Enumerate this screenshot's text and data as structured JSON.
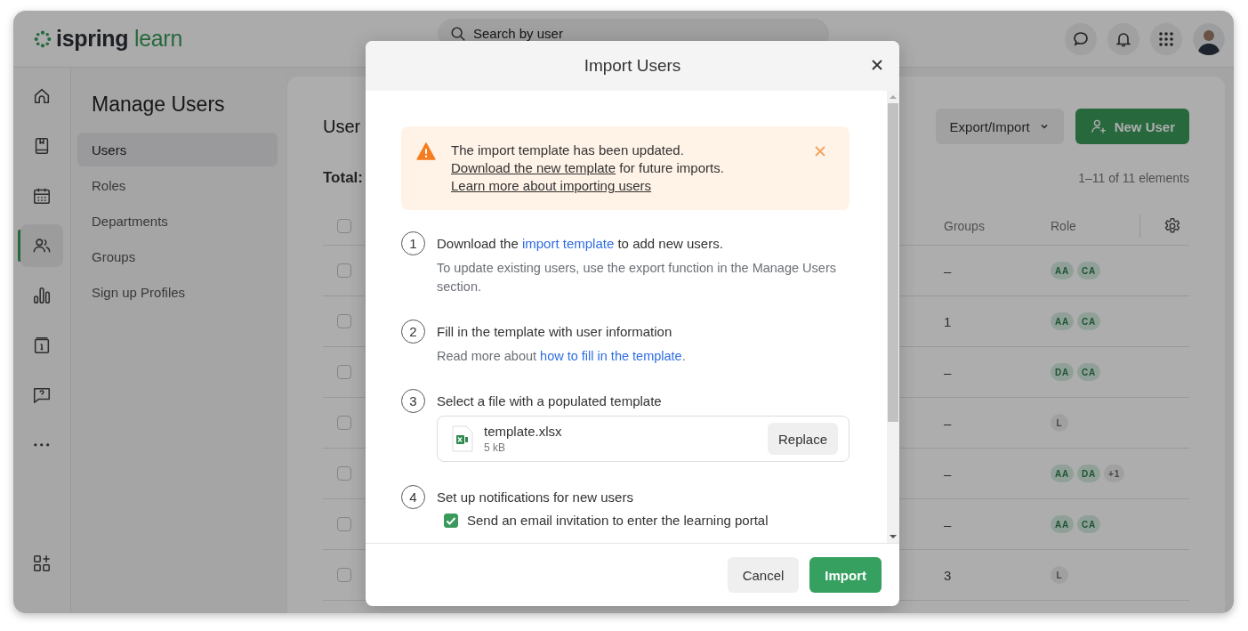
{
  "brand": {
    "name": "ispring",
    "product": "learn"
  },
  "search": {
    "placeholder": "Search by user"
  },
  "rail": [
    {
      "kind": "home",
      "selected": false
    },
    {
      "kind": "book",
      "selected": false
    },
    {
      "kind": "calendar",
      "selected": false
    },
    {
      "kind": "users",
      "selected": true
    },
    {
      "kind": "chart",
      "selected": false
    },
    {
      "kind": "info",
      "selected": false
    },
    {
      "kind": "help",
      "selected": false
    },
    {
      "kind": "more",
      "selected": false
    },
    {
      "kind": "apps",
      "selected": false
    }
  ],
  "sidebar": {
    "title": "Manage Users",
    "items": [
      {
        "label": "Users",
        "selected": true
      },
      {
        "label": "Roles",
        "selected": false
      },
      {
        "label": "Departments",
        "selected": false
      },
      {
        "label": "Groups",
        "selected": false
      },
      {
        "label": "Sign up Profiles",
        "selected": false
      }
    ]
  },
  "content": {
    "title": "User",
    "total_label": "Total:",
    "export_button": "Export/Import",
    "new_button": "New User",
    "range": "1–11 of 11 elements",
    "table": {
      "header_checked": false,
      "columns": [
        "Groups",
        "Role"
      ],
      "rows": [
        {
          "checked": false,
          "groups": "–",
          "roles": [
            {
              "label": "AA",
              "kind": "accent"
            },
            {
              "label": "CA",
              "kind": "accent"
            }
          ]
        },
        {
          "checked": false,
          "groups": "1",
          "roles": [
            {
              "label": "AA",
              "kind": "accent"
            },
            {
              "label": "CA",
              "kind": "accent"
            }
          ]
        },
        {
          "checked": false,
          "groups": "–",
          "roles": [
            {
              "label": "DA",
              "kind": "accent"
            },
            {
              "label": "CA",
              "kind": "accent"
            }
          ]
        },
        {
          "checked": false,
          "groups": "–",
          "roles": [
            {
              "label": "L",
              "kind": "plain"
            }
          ]
        },
        {
          "checked": false,
          "groups": "–",
          "roles": [
            {
              "label": "AA",
              "kind": "accent"
            },
            {
              "label": "DA",
              "kind": "accent"
            },
            {
              "label": "+1",
              "kind": "plain"
            }
          ]
        },
        {
          "checked": false,
          "groups": "–",
          "roles": [
            {
              "label": "AA",
              "kind": "accent"
            },
            {
              "label": "CA",
              "kind": "accent"
            }
          ]
        },
        {
          "checked": false,
          "groups": "3",
          "roles": [
            {
              "label": "L",
              "kind": "plain"
            }
          ]
        }
      ]
    }
  },
  "modal": {
    "title": "Import Users",
    "notice": {
      "segments": [
        {
          "kind": "text",
          "text": "The import template has been updated. "
        },
        {
          "kind": "link",
          "text": "Download the new template"
        },
        {
          "kind": "text",
          "text": " for future imports."
        }
      ],
      "link": "Learn more about importing users"
    },
    "steps": [
      {
        "number": "1",
        "kind": "plain",
        "title": [
          {
            "kind": "text",
            "text": "Download the "
          },
          {
            "kind": "link",
            "text": "import template"
          },
          {
            "kind": "text",
            "text": " to add new users."
          }
        ],
        "note": [
          {
            "kind": "text",
            "text": "To update existing users, use the export function in the Manage Users section."
          }
        ]
      },
      {
        "number": "2",
        "kind": "plain",
        "title": [
          {
            "kind": "text",
            "text": "Fill in the template with user information"
          }
        ],
        "note": [
          {
            "kind": "text",
            "text": "Read more about "
          },
          {
            "kind": "link",
            "text": "how to fill in the template"
          },
          {
            "kind": "text",
            "text": "."
          }
        ]
      },
      {
        "number": "3",
        "kind": "file",
        "title": [
          {
            "kind": "text",
            "text": "Select a file with a populated template"
          }
        ],
        "file": {
          "name": "template.xlsx",
          "size": "5 kB",
          "button": "Replace"
        }
      },
      {
        "number": "4",
        "kind": "option",
        "title": [
          {
            "kind": "text",
            "text": "Set up notifications for new users"
          }
        ],
        "option": {
          "label": "Send an email invitation to enter the learning portal",
          "checked": true
        }
      }
    ],
    "cancel": "Cancel",
    "confirm": "Import"
  }
}
